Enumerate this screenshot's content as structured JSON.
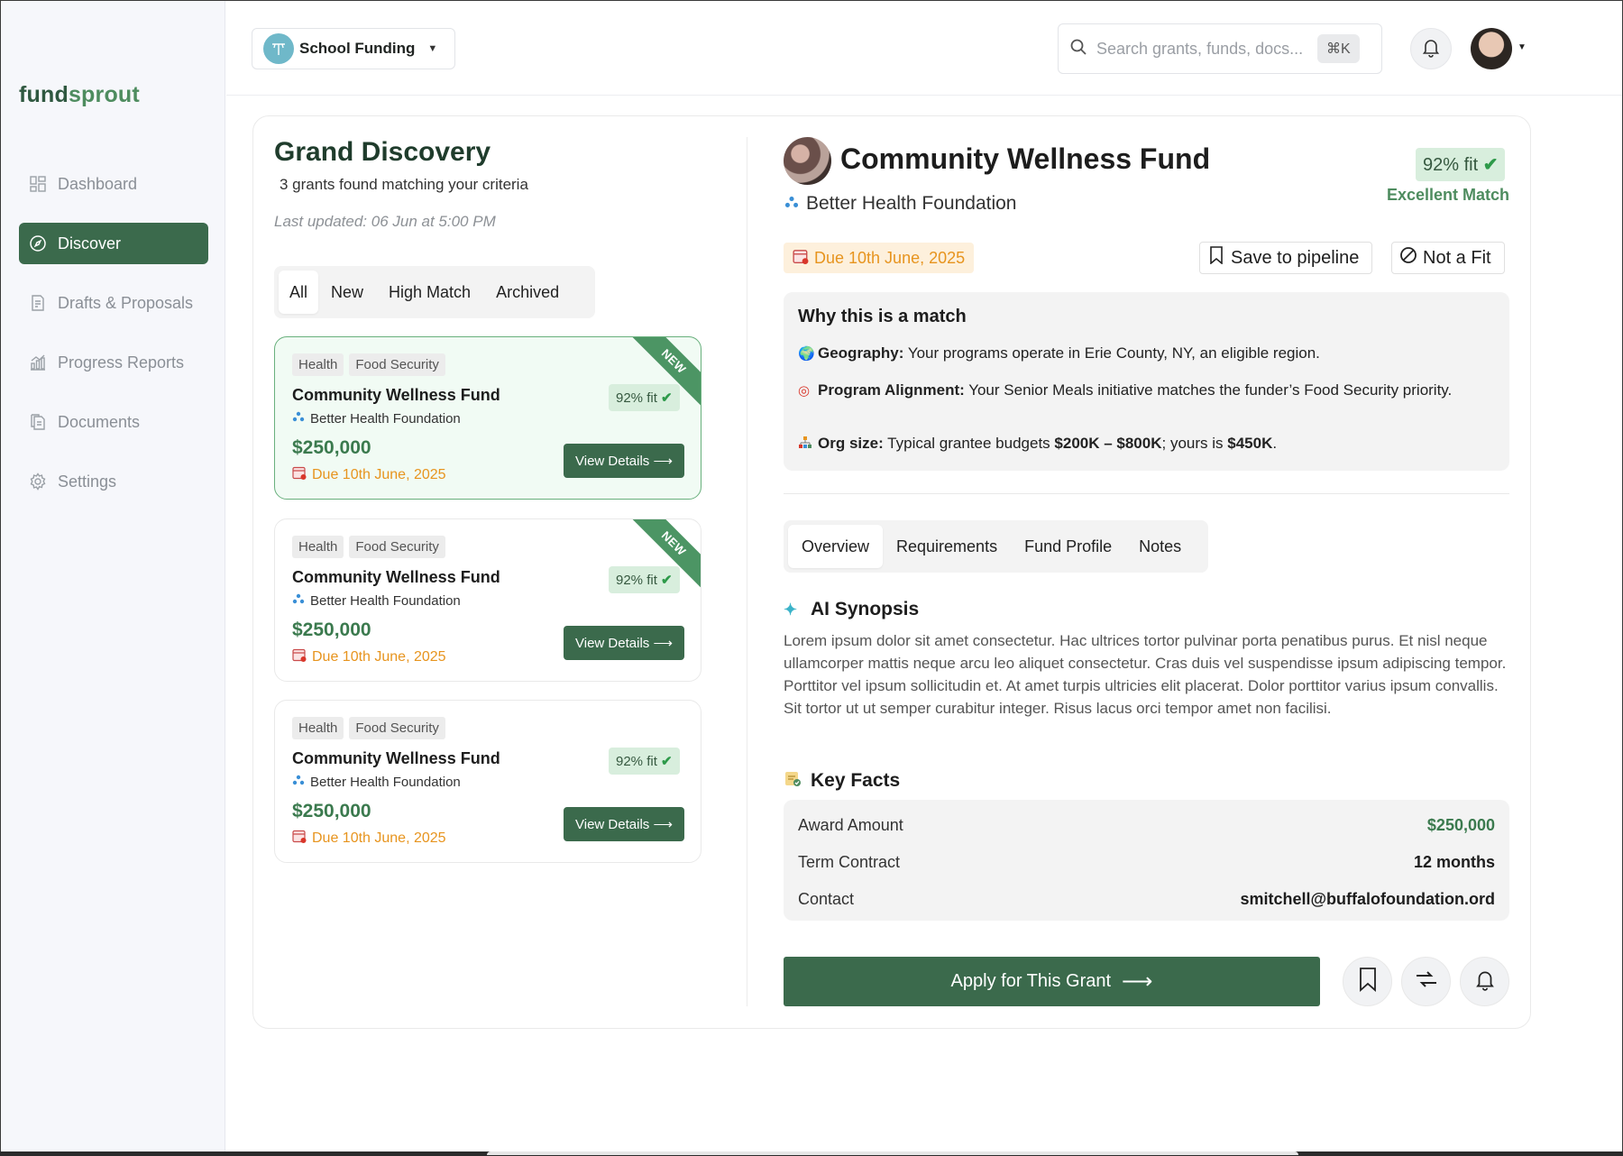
{
  "brand": {
    "logo_part1": "fund",
    "logo_part2": "sprout"
  },
  "sidebar": {
    "items": [
      {
        "label": "Dashboard"
      },
      {
        "label": "Discover"
      },
      {
        "label": "Drafts & Proposals"
      },
      {
        "label": "Progress Reports"
      },
      {
        "label": "Documents"
      },
      {
        "label": "Settings"
      }
    ]
  },
  "header": {
    "org_name": "School Funding",
    "search_placeholder": "Search grants, funds, docs...",
    "search_shortcut": "⌘K"
  },
  "list": {
    "title": "Grand Discovery",
    "subtitle": "3 grants found matching your criteria",
    "updated": "Last updated: 06 Jun at 5:00 PM",
    "filters": [
      "All",
      "New",
      "High Match",
      "Archived"
    ],
    "cards": [
      {
        "tags": [
          "Health",
          "Food Security"
        ],
        "name": "Community Wellness Fund",
        "foundation": "Better Health Foundation",
        "amount": "$250,000",
        "due": "Due 10th June, 2025",
        "fit": "92% fit",
        "button": "View Details",
        "ribbon": "NEW"
      },
      {
        "tags": [
          "Health",
          "Food Security"
        ],
        "name": "Community Wellness Fund",
        "foundation": "Better Health Foundation",
        "amount": "$250,000",
        "due": "Due 10th June, 2025",
        "fit": "92% fit",
        "button": "View Details",
        "ribbon": "NEW"
      },
      {
        "tags": [
          "Health",
          "Food Security"
        ],
        "name": "Community Wellness Fund",
        "foundation": "Better Health Foundation",
        "amount": "$250,000",
        "due": "Due 10th June, 2025",
        "fit": "92% fit",
        "button": "View Details"
      }
    ]
  },
  "detail": {
    "title": "Community Wellness Fund",
    "foundation": "Better Health Foundation",
    "fit": "92% fit",
    "match_label": "Excellent Match",
    "due": "Due 10th June, 2025",
    "save_label": "Save to pipeline",
    "notfit_label": "Not a Fit",
    "why": {
      "title": "Why this is a match",
      "geo_label": "Geography:",
      "geo_text": " Your programs operate in Erie County, NY, an eligible region.",
      "prog_label": "Program Alignment:",
      "prog_text": " Your Senior Meals initiative matches the funder’s Food Security priority.",
      "org_label": "Org size:",
      "org_text1": " Typical grantee budgets ",
      "org_range": "$200K – $800K",
      "org_text2": "; yours is ",
      "org_yours": "$450K",
      "org_text3": "."
    },
    "tabs": [
      "Overview",
      "Requirements",
      "Fund Profile",
      "Notes"
    ],
    "synopsis_title": "AI Synopsis",
    "synopsis": "Lorem ipsum dolor sit amet consectetur. Hac ultrices tortor pulvinar porta penatibus purus. Et nisl neque ullamcorper mattis neque arcu leo aliquet consectetur. Cras duis vel suspendisse ipsum adipiscing tempor. Porttitor vel ipsum sollicitudin et. At amet turpis ultricies elit placerat. Dolor porttitor varius ipsum convallis. Sit tortor ut ut semper curabitur integer. Risus lacus orci tempor amet non facilisi.",
    "facts_title": "Key Facts",
    "facts": [
      {
        "label": "Award Amount",
        "value": "$250,000"
      },
      {
        "label": "Term Contract",
        "value": "12 months"
      },
      {
        "label": "Contact",
        "value": "smitchell@buffalofoundation.ord"
      }
    ],
    "apply_label": "Apply for This Grant"
  },
  "colors": {
    "brand_green": "#3b6a4c",
    "accent_green": "#4e8c5f",
    "due_orange": "#e7941e",
    "fit_bg": "#d8eedd"
  }
}
